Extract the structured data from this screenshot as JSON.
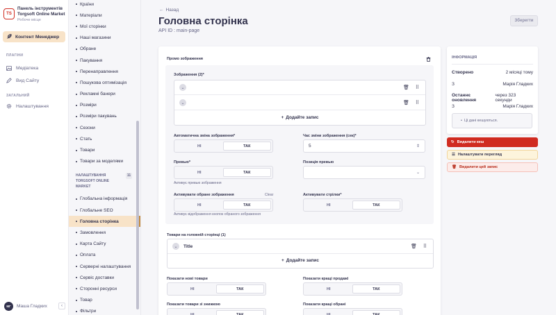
{
  "brand": {
    "logo": "TS",
    "title": "Панель інструментів Torgsoft Online Market",
    "subtitle": "Робоче місце"
  },
  "nav": {
    "active": {
      "label": "Контент Менеджер",
      "icon": "feather-icon"
    },
    "plugins_title": "ПЛАГІНИ",
    "plugins": [
      {
        "label": "Медіатека",
        "icon": "image-icon"
      },
      {
        "label": "Вид Сайту",
        "icon": "pencil-icon"
      }
    ],
    "general_title": "ЗАГАЛЬНИЙ",
    "general": [
      {
        "label": "Налаштування",
        "icon": "gear-icon"
      }
    ],
    "user": {
      "initials": "МГ",
      "name": "Маша Гладких"
    }
  },
  "subnav": {
    "items_top": [
      "Країни",
      "Матеріали",
      "Мої сторінки",
      "Наші магазини",
      "Обране",
      "Пакування",
      "Перенаправлення",
      "Пошукова оптимізація",
      "Рекламні банери",
      "Розміри",
      "Розміри пакувань",
      "Сезони",
      "Стать",
      "Товари",
      "Товари за моделями"
    ],
    "group_title": "НАЛАШТУВАННЯ TORGSOFT ONLINE MARKET",
    "group_count": "11",
    "items_group": [
      "Глобальна інформація",
      "Глобальне SEO",
      "Головна сторінка",
      "Замовлення",
      "Карта Сайту",
      "Оплата",
      "Серверні налаштування",
      "Сервіс доставки",
      "Сторонні ресурси",
      "Товар",
      "Фільтри"
    ],
    "active_item": "Головна сторінка"
  },
  "header": {
    "back": "Назад",
    "title": "Головна сторінка",
    "api_id": "API ID : main-page",
    "save": "Зберегти"
  },
  "promo": {
    "title": "Промо зображення",
    "images_label": "Зображення (2)*",
    "add_entry": "Додайте запис",
    "auto_change_label": "Автоматична зміна зображення*",
    "interval_label": "Час зміни зображення (сек)*",
    "interval_value": "5",
    "preview_label": "Превью*",
    "preview_hint": "Активує превью зображення",
    "preview_position_label": "Позиція превью",
    "activate_selected_label": "Активувати обране зображення",
    "clear": "Clear",
    "activate_selected_hint": "Активує відображення кнопок обраного зображення",
    "activate_arrows_label": "Активувати стрілки*",
    "no": "НІ",
    "yes": "ТАК"
  },
  "products": {
    "label": "Товари на головній сторінці (1)",
    "entry_title": "Title",
    "add_entry": "Додайте запис",
    "show_new_label": "Показати нові товари",
    "show_best_label": "Показати кращі продажі",
    "show_discount_label": "Показати товари зі знижкою",
    "show_favorites_label": "Показати кращі обрані"
  },
  "info": {
    "heading": "ІНФОРМАЦІЯ",
    "created_label": "Створено",
    "created_value": "2 місяці тому",
    "created_by_prefix": "З",
    "created_by": "Марія Гладких",
    "updated_label": "Останнє оновлення",
    "updated_value": "через 323 секунди",
    "updated_by_prefix": "З",
    "updated_by": "Марія Гладких",
    "cache_note": "Ці дані кешуються."
  },
  "actions": {
    "delete_cache": "Видалити кеш",
    "configure_view": "Налаштувати перегляд",
    "delete_entry": "Видалити цей запис"
  },
  "colors": {
    "accent": "#f8e3c8",
    "danger": "#d02b20",
    "danger_light": "#fcecea",
    "warning_light": "#fdf4dc"
  }
}
